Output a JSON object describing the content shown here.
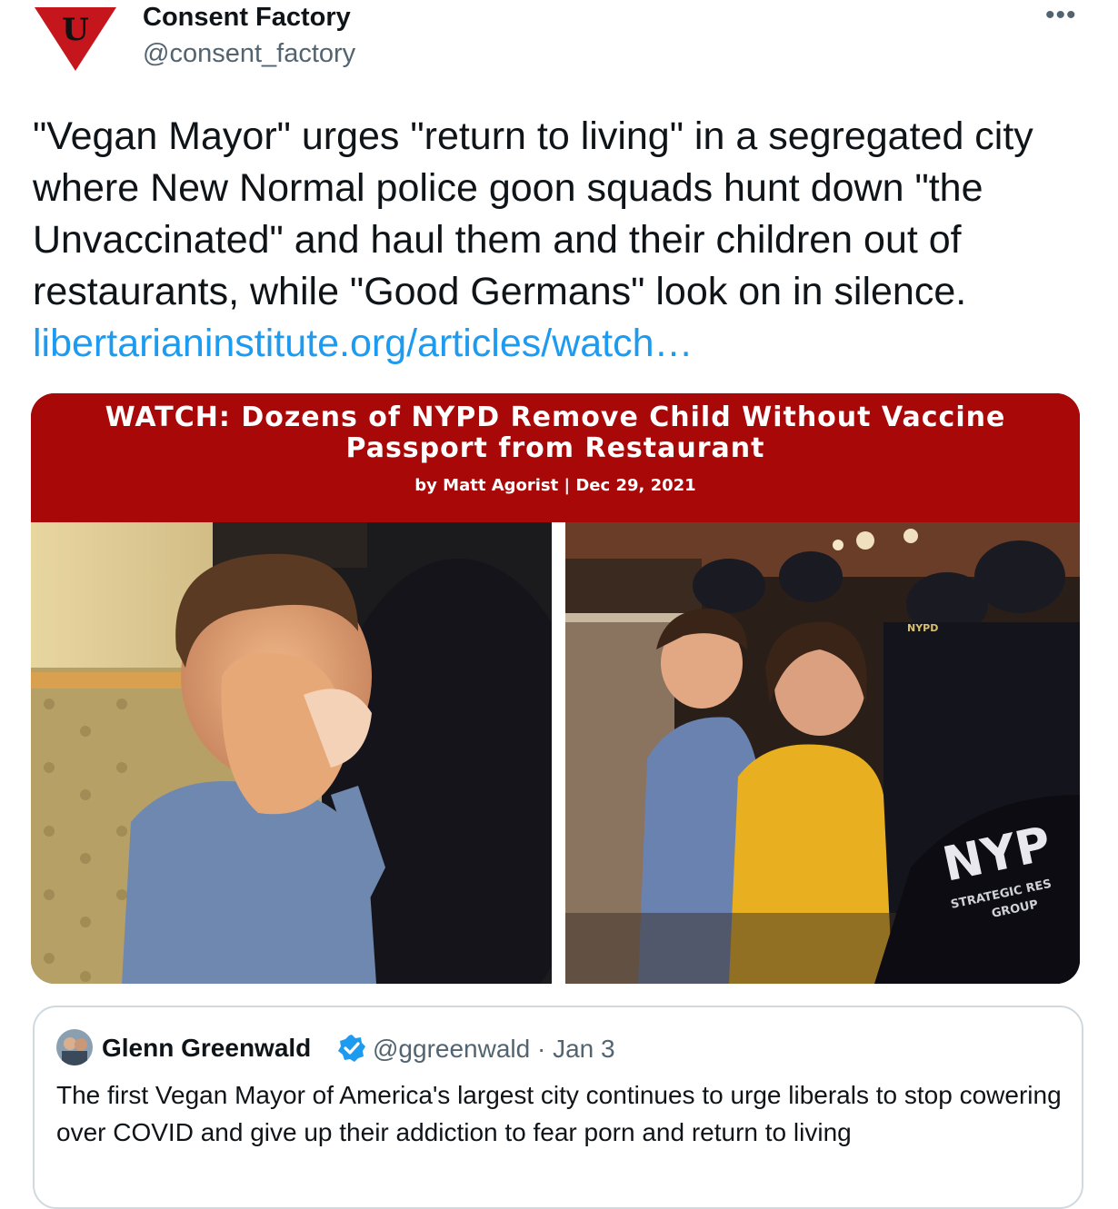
{
  "author": {
    "name": "Consent Factory",
    "handle": "@consent_factory",
    "avatar_letter": "U",
    "avatar_color": "#c4161c"
  },
  "more_label": "•••",
  "tweet": {
    "text": "\"Vegan Mayor\" urges \"return to living\" in a segregated city where New Normal police goon squads hunt down \"the Unvaccinated\" and haul them and their children out of restaurants, while \"Good Germans\" look on in silence. ",
    "link": "libertarianinstitute.org/articles/watch…"
  },
  "card": {
    "title": "WATCH: Dozens of NYPD Remove Child Without Vaccine Passport from Restaurant",
    "byline": "by Matt Agorist | Dec 29, 2021",
    "banner_color": "#a80808",
    "photo_right_texts": {
      "cap_badge": "NYPD",
      "jacket_big": "NYP",
      "jacket_small": "STRATEGIC RES",
      "jacket_small2": "GROUP"
    }
  },
  "quote": {
    "name": "Glenn Greenwald",
    "handle_date": "@ggreenwald · Jan 3",
    "text": "The first Vegan Mayor of America's largest city continues to urge liberals to stop cowering over COVID and give up their addiction to fear porn and return to living"
  },
  "colors": {
    "link": "#1d9bf0",
    "muted": "#536471",
    "verified": "#1d9bf0"
  }
}
